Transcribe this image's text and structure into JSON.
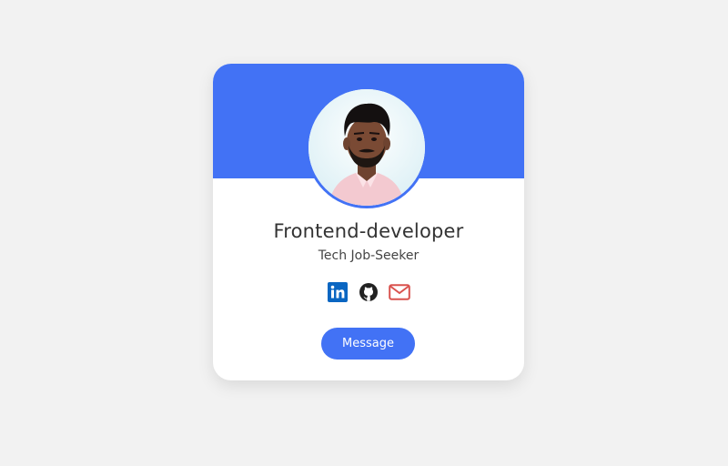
{
  "profile": {
    "title": "Frontend-developer",
    "subtitle": "Tech Job-Seeker",
    "avatar_alt": "Profile photo"
  },
  "social": [
    {
      "icon": "linkedin-icon",
      "color": "#0a66c2"
    },
    {
      "icon": "github-icon",
      "color": "#222222"
    },
    {
      "icon": "mail-icon",
      "color": "#d9534f"
    }
  ],
  "actions": {
    "message_label": "Message"
  },
  "colors": {
    "accent": "#4272f5",
    "background": "#f2f2f2",
    "card": "#ffffff"
  }
}
